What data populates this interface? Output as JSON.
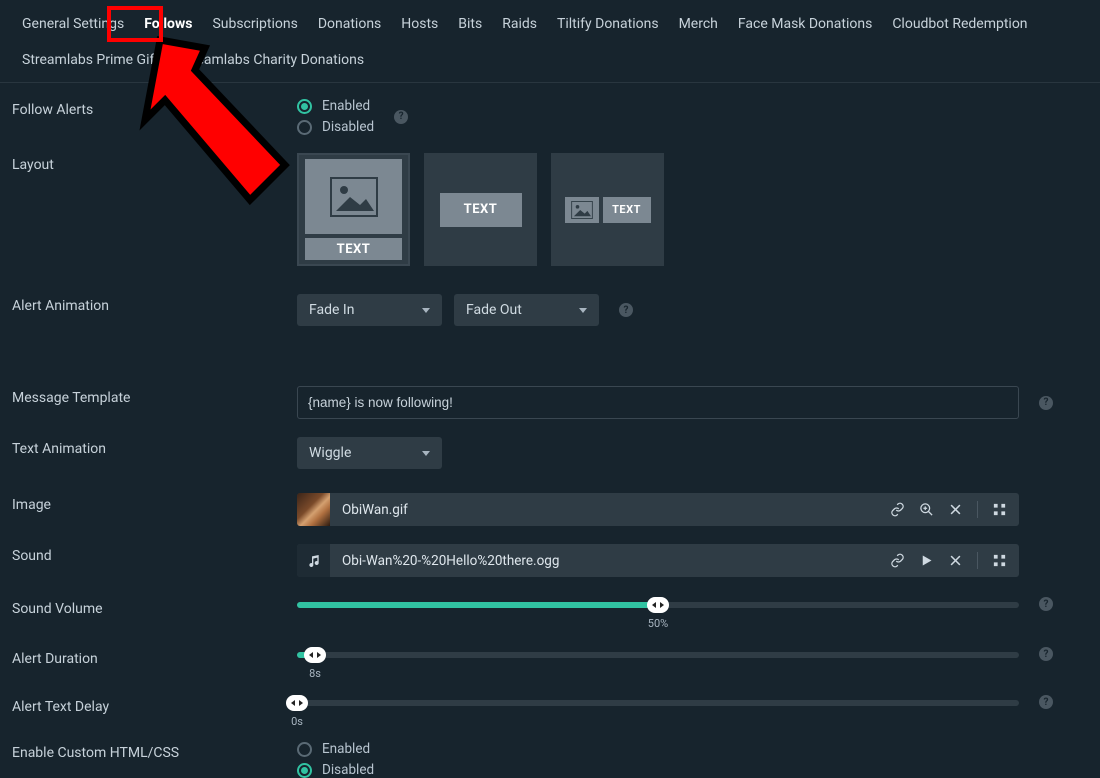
{
  "tabs": [
    "General Settings",
    "Follows",
    "Subscriptions",
    "Donations",
    "Hosts",
    "Bits",
    "Raids",
    "Tiltify Donations",
    "Merch",
    "Face Mask Donations",
    "Cloudbot Redemption",
    "Streamlabs Prime Gift",
    "Streamlabs Charity Donations"
  ],
  "active_tab": "Follows",
  "labels": {
    "follow_alerts": "Follow Alerts",
    "layout": "Layout",
    "alert_animation": "Alert Animation",
    "message_template": "Message Template",
    "text_animation": "Text Animation",
    "image": "Image",
    "sound": "Sound",
    "sound_volume": "Sound Volume",
    "alert_duration": "Alert Duration",
    "alert_text_delay": "Alert Text Delay",
    "enable_custom": "Enable Custom HTML/CSS"
  },
  "radio": {
    "enabled": "Enabled",
    "disabled": "Disabled"
  },
  "text_badge": "TEXT",
  "animation_in": "Fade In",
  "animation_out": "Fade Out",
  "message_template_value": "{name} is now following!",
  "text_animation_value": "Wiggle",
  "image_file": "ObiWan.gif",
  "sound_file": "Obi-Wan%20-%20Hello%20there.ogg",
  "volume": {
    "pct": 50,
    "label": "50%"
  },
  "duration": {
    "pct": 2.5,
    "label": "8s"
  },
  "delay": {
    "pct": 0,
    "label": "0s"
  }
}
